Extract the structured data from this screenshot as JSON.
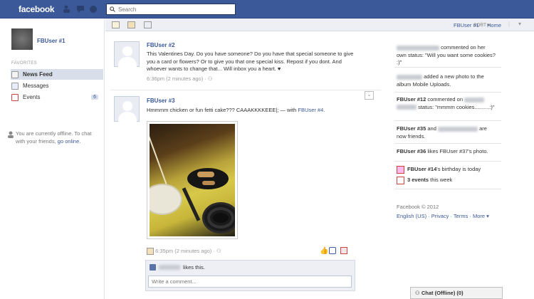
{
  "app": {
    "logo": "facebook"
  },
  "search": {
    "placeholder": "Search"
  },
  "left": {
    "user_name": "FBUser #1",
    "favorites_label": "FAVORITES",
    "nav": [
      {
        "label": "News Feed",
        "icon": "news-feed-icon"
      },
      {
        "label": "Messages",
        "icon": "messages-icon"
      },
      {
        "label": "Events",
        "icon": "events-icon",
        "count": "6"
      }
    ],
    "offline_text": "You are currently offline. To chat with your friends,",
    "offline_link": "go online."
  },
  "toolbar": {
    "sort_label": "SORT",
    "user_link": "FBUser #1",
    "home_link": "Home"
  },
  "posts": [
    {
      "author": "FBUser #2",
      "text": "This Valentines Day. Do you have someone? Do you have that special someone to give you a card or flowers? Or to give you that one special kiss. Repost if you dont. And whoever wants to change that... Will inbox you a heart. ♥",
      "meta": "6:36pm (2 minutes ago) ·"
    },
    {
      "author": "FBUser #3",
      "text": "Hmmmm chicken or fun fetti cake??? CAAAKKKKEEE|; — with ",
      "tag": "FBUser #4.",
      "meta": "6:35pm (2 minutes ago) ·",
      "likes_suffix": "likes this.",
      "comment_placeholder": "Write a comment..."
    }
  ],
  "ticker": [
    {
      "text": "commented on her own status: \"Will you want some cookies? :)\""
    },
    {
      "text": "added a new photo to the album Mobile Uploads."
    },
    {
      "name": "FBUser #12",
      "text": "commented on",
      "text2": "status: \"mmmm cookies..........:)\""
    },
    {
      "name": "FBUser #35",
      "text": "and",
      "text2": "are now friends."
    },
    {
      "name": "FBUser #36",
      "text": "likes FBUser #37's photo."
    }
  ],
  "birthdays": {
    "name": "FBUser #14",
    "suffix": "'s birthday is today"
  },
  "events": {
    "link": "3 events",
    "suffix": "this week"
  },
  "footer": {
    "copyright": "Facebook © 2012",
    "links": [
      "English (US)",
      "Privacy",
      "Terms",
      "More ▾"
    ]
  },
  "chat": {
    "label": "Chat (Offline) (0)"
  }
}
